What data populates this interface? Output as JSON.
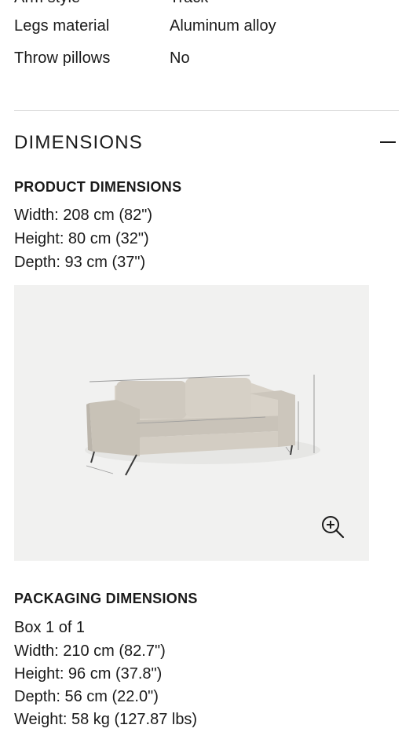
{
  "specs": {
    "cut_row": {
      "label": "Arm style",
      "value": "Track"
    },
    "rows": [
      {
        "label": "Legs material",
        "value": "Aluminum alloy"
      },
      {
        "label": "Throw pillows",
        "value": "No"
      }
    ]
  },
  "dimensions": {
    "title": "DIMENSIONS",
    "product": {
      "heading": "PRODUCT DIMENSIONS",
      "width": "Width: 208 cm (82\")",
      "height": "Height: 80 cm (32\")",
      "depth": "Depth: 93 cm (37\")"
    },
    "image": {
      "alt": "Sofa with dimension lines",
      "zoom_icon": "zoom-in-icon"
    },
    "packaging": {
      "heading": "PACKAGING DIMENSIONS",
      "box": "Box 1 of 1",
      "width": "Width: 210 cm (82.7\")",
      "height": "Height: 96 cm (37.8\")",
      "depth": "Depth: 56 cm (22.0\")",
      "weight": "Weight: 58 kg (127.87 lbs)"
    }
  }
}
